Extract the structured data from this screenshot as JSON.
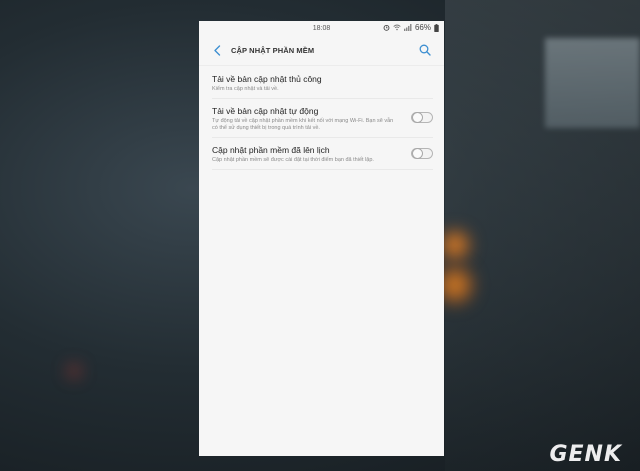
{
  "status_bar": {
    "time": "18:08",
    "battery": "66%"
  },
  "app_bar": {
    "title": "CẬP NHẬT PHẦN MỀM"
  },
  "settings": [
    {
      "title": "Tải về bản cập nhật thủ công",
      "description": "Kiểm tra cập nhật và tải về.",
      "has_toggle": false
    },
    {
      "title": "Tải về bản cập nhật tự động",
      "description": "Tự động tải về cập nhật phần mềm khi kết nối với mạng Wi-Fi. Bạn sẽ vẫn có thể sử dụng thiết bị trong quá trình tải về.",
      "has_toggle": true,
      "enabled": false
    },
    {
      "title": "Cập nhật phần mềm đã lên lịch",
      "description": "Cập nhật phần mềm sẽ được cài đặt tại thời điểm bạn đã thiết lập.",
      "has_toggle": true,
      "enabled": false
    }
  ],
  "watermark": "GENK",
  "colors": {
    "accent": "#3d8fd1",
    "screen_bg": "#f6f6f6"
  }
}
